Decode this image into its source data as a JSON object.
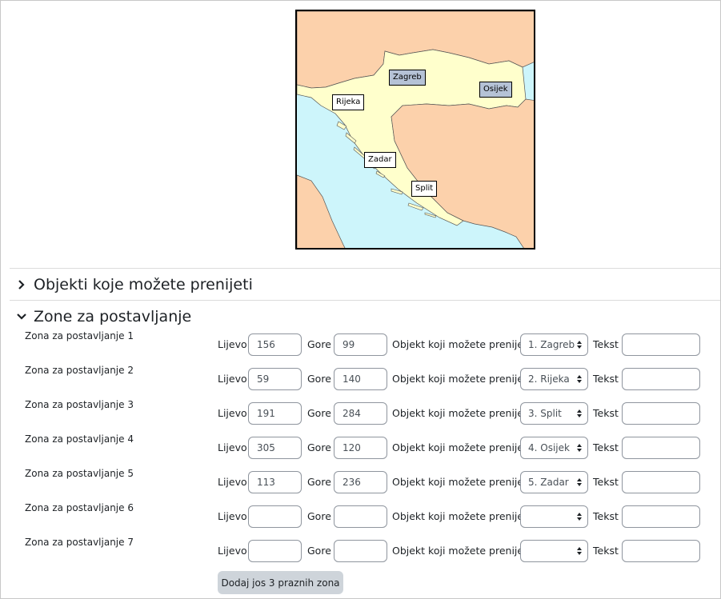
{
  "map": {
    "colors": {
      "sea": "#cdf5fb",
      "croatia": "#ffffcc",
      "neighbors": "#fcd1ab",
      "dropped_label": "#b5c2d6"
    },
    "labels": [
      {
        "text": "Zagreb",
        "dropped": true
      },
      {
        "text": "Osijek",
        "dropped": true
      },
      {
        "text": "Rijeka",
        "dropped": false
      },
      {
        "text": "Zadar",
        "dropped": false
      },
      {
        "text": "Split",
        "dropped": false
      }
    ]
  },
  "sections": {
    "draggables": {
      "title": "Objekti koje možete prenijeti",
      "expanded": false
    },
    "dropzones": {
      "title": "Zone za postavljanje",
      "expanded": true
    }
  },
  "field_labels": {
    "left": "Lijevo",
    "top": "Gore",
    "draggable": "Objekt koji možete prenijeti",
    "text": "Tekst"
  },
  "dropzones": [
    {
      "label": "Zona za postavljanje 1",
      "left": "156",
      "top": "99",
      "item": "1. Zagreb",
      "text": ""
    },
    {
      "label": "Zona za postavljanje 2",
      "left": "59",
      "top": "140",
      "item": "2. Rijeka",
      "text": ""
    },
    {
      "label": "Zona za postavljanje 3",
      "left": "191",
      "top": "284",
      "item": "3. Split",
      "text": ""
    },
    {
      "label": "Zona za postavljanje 4",
      "left": "305",
      "top": "120",
      "item": "4. Osijek",
      "text": ""
    },
    {
      "label": "Zona za postavljanje 5",
      "left": "113",
      "top": "236",
      "item": "5. Zadar",
      "text": ""
    },
    {
      "label": "Zona za postavljanje 6",
      "left": "",
      "top": "",
      "item": "",
      "text": ""
    },
    {
      "label": "Zona za postavljanje 7",
      "left": "",
      "top": "",
      "item": "",
      "text": ""
    }
  ],
  "add_button": "Dodaj jos 3 praznih zona"
}
